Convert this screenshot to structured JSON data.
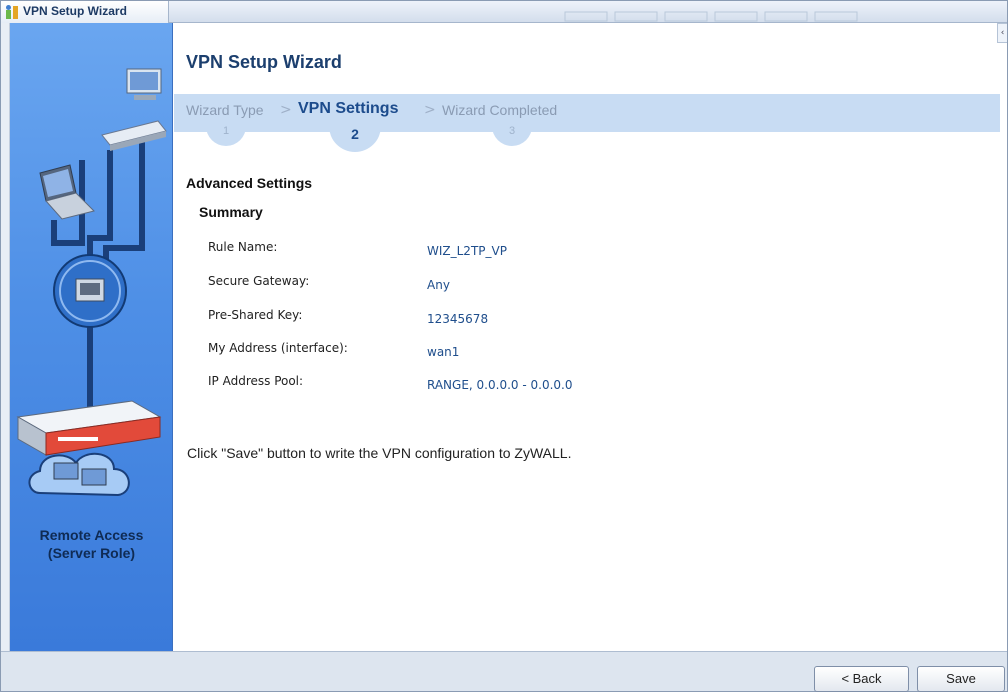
{
  "window": {
    "title": "VPN Setup Wizard"
  },
  "sidebar": {
    "caption_line1": "Remote Access",
    "caption_line2": "(Server Role)"
  },
  "main": {
    "title": "VPN Setup Wizard",
    "steps": [
      {
        "label": "Wizard Type",
        "number": "1"
      },
      {
        "label": "VPN Settings",
        "number": "2"
      },
      {
        "label": "Wizard Completed",
        "number": "3"
      }
    ],
    "step_separator": ">",
    "section_title": "Advanced Settings",
    "summary_title": "Summary",
    "summary": [
      {
        "label": "Rule Name:",
        "value": "WIZ_L2TP_VP"
      },
      {
        "label": "Secure Gateway:",
        "value": "Any"
      },
      {
        "label": "Pre-Shared Key:",
        "value": "12345678"
      },
      {
        "label": "My Address (interface):",
        "value": "wan1"
      },
      {
        "label": "IP Address Pool:",
        "value": "RANGE, 0.0.0.0 - 0.0.0.0"
      }
    ],
    "note": "Click \"Save\" button to write the VPN configuration to ZyWALL."
  },
  "buttons": {
    "back": "< Back",
    "save": "Save"
  },
  "colors": {
    "panel_blue": "#4e8fe6",
    "step_bar": "#c8dcf3",
    "title_blue": "#1c3f6e",
    "value_blue": "#1f4e8c"
  }
}
